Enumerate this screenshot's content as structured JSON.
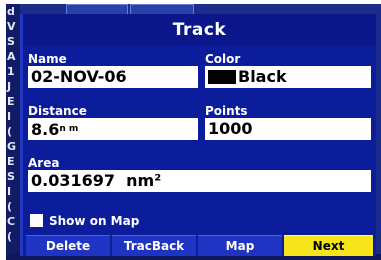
{
  "dialog": {
    "title": "Track",
    "name_label": "Name",
    "name_value": "02-NOV-06",
    "color_label": "Color",
    "color_value": "Black",
    "distance_label": "Distance",
    "distance_value": "8.6",
    "distance_unit": "n m",
    "points_label": "Points",
    "points_value": "1000",
    "area_label": "Area",
    "area_value": "0.031697",
    "area_unit": "nm²",
    "show_on_map_label": "Show on Map",
    "show_on_map_checked": false
  },
  "buttons": {
    "delete": "Delete",
    "tracback": "TracBack",
    "map": "Map",
    "next": "Next"
  },
  "background": {
    "strip_letters": [
      "d",
      "V",
      "S",
      "A",
      "1",
      "J",
      "E",
      "I",
      "(",
      "G",
      "E",
      "S",
      "I",
      "(",
      "C",
      "("
    ]
  },
  "colors": {
    "dialog_bg": "#0b1d9a",
    "title_bg": "#0a168a",
    "button_bg": "#2034c4",
    "button_active": "#f5e51a",
    "field_bg": "#ffffff"
  }
}
